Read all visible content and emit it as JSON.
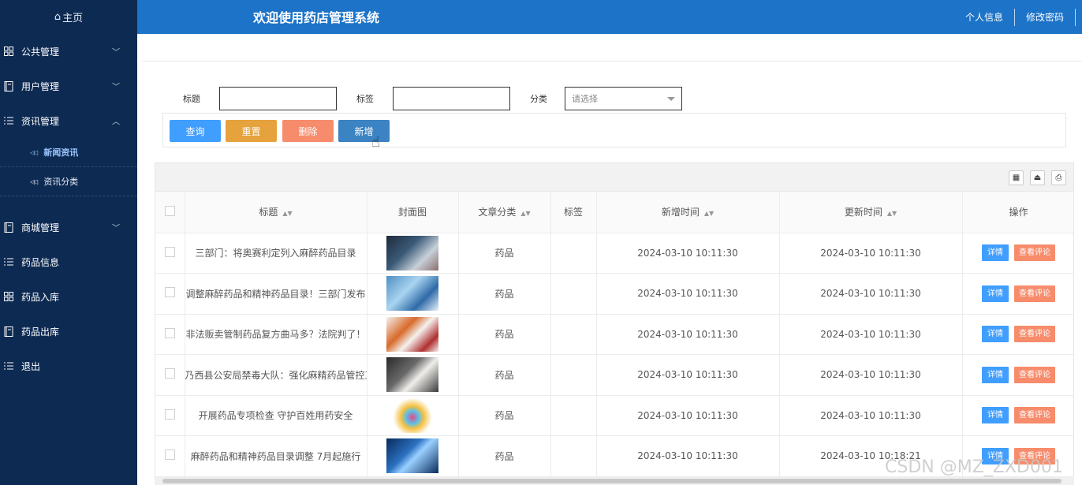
{
  "sidebar": {
    "home": "主页",
    "items": [
      {
        "label": "公共管理",
        "icon": "grid-icon",
        "chev": "﹀"
      },
      {
        "label": "用户管理",
        "icon": "book-icon",
        "chev": "﹀"
      },
      {
        "label": "资讯管理",
        "icon": "list-icon",
        "chev": "︿"
      }
    ],
    "sub_items": [
      {
        "label": "新闻资讯"
      },
      {
        "label": "资讯分类"
      }
    ],
    "items2": [
      {
        "label": "商城管理",
        "icon": "book-icon",
        "chev": "﹀"
      },
      {
        "label": "药品信息",
        "icon": "list-icon"
      },
      {
        "label": "药品入库",
        "icon": "grid-icon"
      },
      {
        "label": "药品出库",
        "icon": "book-icon"
      },
      {
        "label": "退出",
        "icon": "list-icon"
      }
    ]
  },
  "header": {
    "title": "欢迎使用药店管理系统",
    "profile": "个人信息",
    "change_password": "修改密码"
  },
  "filters": {
    "title_label": "标题",
    "tag_label": "标签",
    "category_label": "分类",
    "category_placeholder": "请选择"
  },
  "buttons": {
    "search": "查询",
    "reset": "重置",
    "delete": "删除",
    "add": "新增"
  },
  "table": {
    "columns": [
      "标题",
      "封面图",
      "文章分类",
      "标签",
      "新增时间",
      "更新时间",
      "操作"
    ],
    "rows": [
      {
        "title": "三部门：将奥赛利定列入麻醉药品目录",
        "category": "药品",
        "tag": "",
        "created": "2024-03-10 10:11:30",
        "updated": "2024-03-10 10:11:30"
      },
      {
        "title": "调整麻醉药品和精神药品目录！三部门发布",
        "category": "药品",
        "tag": "",
        "created": "2024-03-10 10:11:30",
        "updated": "2024-03-10 10:11:30"
      },
      {
        "title": "非法贩卖管制药品复方曲马多？法院判了！",
        "category": "药品",
        "tag": "",
        "created": "2024-03-10 10:11:30",
        "updated": "2024-03-10 10:11:30"
      },
      {
        "title": "乃西县公安局禁毒大队：强化麻精药品管控工作",
        "category": "药品",
        "tag": "",
        "created": "2024-03-10 10:11:30",
        "updated": "2024-03-10 10:11:30"
      },
      {
        "title": "开展药品专项检查 守护百姓用药安全",
        "category": "药品",
        "tag": "",
        "created": "2024-03-10 10:11:30",
        "updated": "2024-03-10 10:11:30"
      },
      {
        "title": "麻醉药品和精神药品目录调整 7月起施行",
        "category": "药品",
        "tag": "",
        "created": "2024-03-10 10:11:30",
        "updated": "2024-03-10 10:18:21"
      }
    ],
    "detail_label": "详情",
    "comment_label": "查看评论"
  },
  "watermark": "CSDN @MZ_ZXD001"
}
